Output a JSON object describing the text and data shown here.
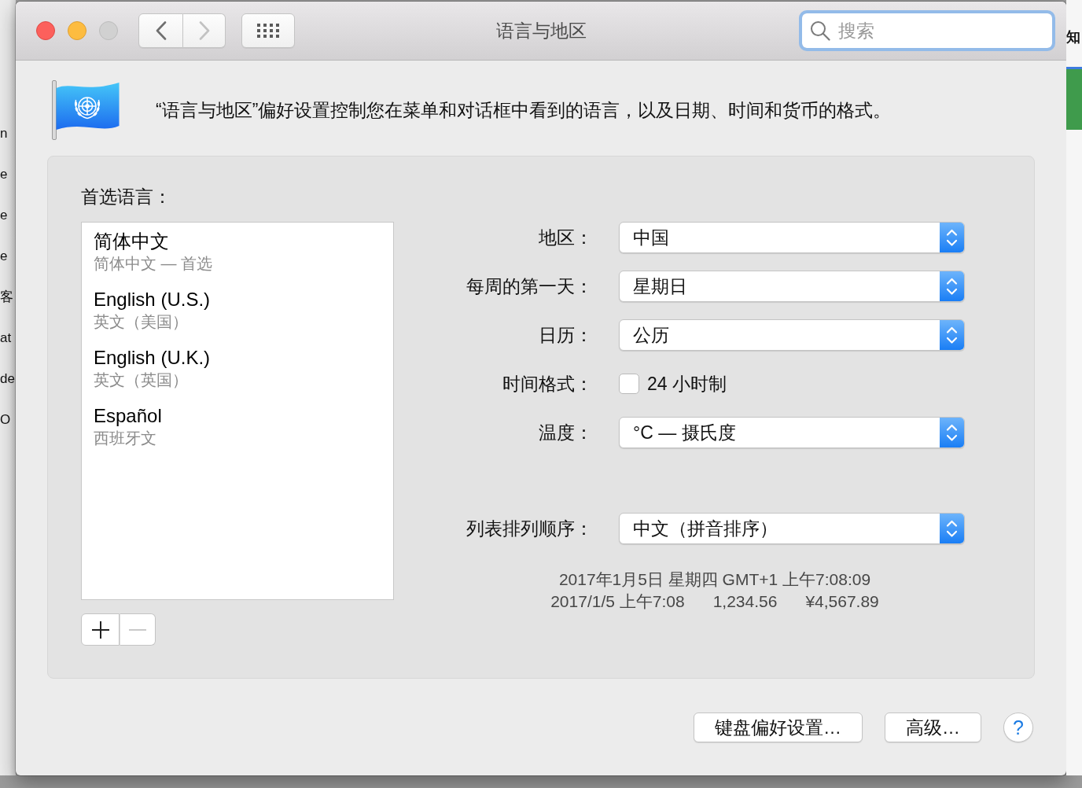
{
  "background": {
    "left_lines": [
      "n",
      "e",
      "e",
      "e",
      "客",
      "at",
      "de",
      "O"
    ],
    "right_lines": [
      "知"
    ]
  },
  "window": {
    "title": "语言与地区",
    "traffic_lights": [
      {
        "kind": "close",
        "disabled": false
      },
      {
        "kind": "minimize",
        "disabled": false
      },
      {
        "kind": "zoom",
        "disabled": true
      }
    ],
    "nav_buttons": [
      {
        "kind": "back",
        "disabled": false
      },
      {
        "kind": "forward",
        "disabled": true
      }
    ],
    "search": {
      "placeholder": "搜索",
      "focused": true
    }
  },
  "header": {
    "description": "“语言与地区”偏好设置控制您在菜单和对话框中看到的语言，以及日期、时间和货币的格式。"
  },
  "preferred_languages": {
    "label": "首选语言：",
    "items": [
      {
        "name": "简体中文",
        "detail": "简体中文 — 首选",
        "selected": false
      },
      {
        "name": "English (U.S.)",
        "detail": "英文（美国）",
        "selected": false
      },
      {
        "name": "English (U.K.)",
        "detail": "英文（英国）",
        "selected": false
      },
      {
        "name": "Español",
        "detail": "西班牙文",
        "selected": false
      }
    ],
    "buttons": [
      {
        "kind": "add",
        "disabled": false
      },
      {
        "kind": "remove",
        "disabled": true
      }
    ]
  },
  "settings": [
    {
      "kind": "popup",
      "label": "地区：",
      "value": "中国"
    },
    {
      "kind": "popup",
      "label": "每周的第一天：",
      "value": "星期日"
    },
    {
      "kind": "popup",
      "label": "日历：",
      "value": "公历"
    },
    {
      "kind": "checkbox",
      "label": "时间格式：",
      "text": "24 小时制",
      "checked": false
    },
    {
      "kind": "popup",
      "label": "温度：",
      "value": "°C — 摄氏度"
    }
  ],
  "list_sort_order": {
    "label": "列表排列顺序：",
    "value": "中文（拼音排序）"
  },
  "sample": {
    "date_long": "2017年1月5日 星期四 GMT+1 上午7:08:09",
    "date_short": "2017/1/5 上午7:08",
    "number": "1,234.56",
    "currency": "¥4,567.89"
  },
  "footer": {
    "buttons": [
      {
        "label": "键盘偏好设置…"
      },
      {
        "label": "高级…"
      }
    ],
    "help": {
      "label": "?"
    }
  }
}
